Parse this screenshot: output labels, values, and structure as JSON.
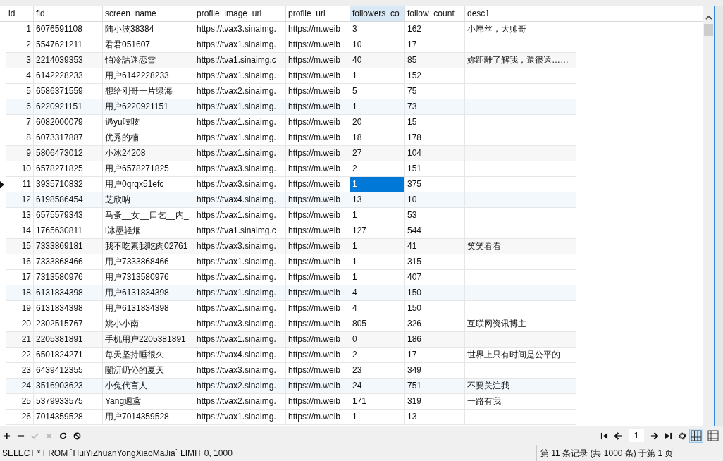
{
  "table": {
    "columns": [
      {
        "label": "id",
        "selected": false
      },
      {
        "label": "fid",
        "selected": false
      },
      {
        "label": "screen_name",
        "selected": false
      },
      {
        "label": "profile_image_url",
        "selected": false
      },
      {
        "label": "profile_url",
        "selected": false
      },
      {
        "label": "followers_co",
        "selected": true
      },
      {
        "label": "follow_count",
        "selected": false
      },
      {
        "label": "desc1",
        "selected": false
      }
    ],
    "rows": [
      {
        "selected": false,
        "cells": [
          "1",
          "6076591108",
          "陆小波38384",
          "https://tvax3.sinaimg.",
          "https://m.weib",
          "3",
          "162",
          "小屌丝，大帅哥"
        ]
      },
      {
        "selected": false,
        "cells": [
          "2",
          "5547621211",
          "君君051607",
          "https://tvax1.sinaimg.",
          "https://m.weib",
          "10",
          "17",
          ""
        ]
      },
      {
        "selected": false,
        "cells": [
          "3",
          "2214039353",
          "怕冷詁迷恋雪",
          "https://tva1.sinaimg.c",
          "https://m.weib",
          "40",
          "85",
          "妳距離了解我，還很遠……"
        ]
      },
      {
        "selected": false,
        "cells": [
          "4",
          "6142228233",
          "用户6142228233",
          "https://tvax1.sinaimg.",
          "https://m.weib",
          "1",
          "152",
          ""
        ]
      },
      {
        "selected": false,
        "cells": [
          "5",
          "6586371559",
          "想给刚哥一片绿海",
          "https://tvax2.sinaimg.",
          "https://m.weib",
          "5",
          "75",
          ""
        ]
      },
      {
        "selected": false,
        "cells": [
          "6",
          "6220921151",
          "用户6220921151",
          "https://tvax1.sinaimg.",
          "https://m.weib",
          "1",
          "73",
          ""
        ]
      },
      {
        "selected": false,
        "cells": [
          "7",
          "6082000079",
          "遇yu吱吱",
          "https://tvax1.sinaimg.",
          "https://m.weib",
          "20",
          "15",
          ""
        ]
      },
      {
        "selected": false,
        "cells": [
          "8",
          "6073317887",
          "优秀的楠",
          "https://tvax1.sinaimg.",
          "https://m.weib",
          "18",
          "178",
          ""
        ]
      },
      {
        "selected": false,
        "cells": [
          "9",
          "5806473012",
          "小冰24208",
          "https://tvax1.sinaimg.",
          "https://m.weib",
          "27",
          "104",
          ""
        ]
      },
      {
        "selected": false,
        "cells": [
          "10",
          "6578271825",
          "用户6578271825",
          "https://tvax3.sinaimg.",
          "https://m.weib",
          "2",
          "151",
          ""
        ]
      },
      {
        "selected": true,
        "cells": [
          "11",
          "3935710832",
          "用户0qrqx51efc",
          "https://tvax3.sinaimg.",
          "https://m.weib",
          "1",
          "375",
          ""
        ]
      },
      {
        "selected": false,
        "cells": [
          "12",
          "6198586454",
          "芝欣呐",
          "https://tvax4.sinaimg.",
          "https://m.weib",
          "13",
          "10",
          ""
        ]
      },
      {
        "selected": false,
        "cells": [
          "13",
          "6575579343",
          "马蚤__女__口乞__内_",
          "https://tvax1.sinaimg.",
          "https://m.weib",
          "1",
          "53",
          ""
        ]
      },
      {
        "selected": false,
        "cells": [
          "14",
          "1765630811",
          "i冰墨轻烟",
          "https://tva1.sinaimg.c",
          "https://m.weib",
          "127",
          "544",
          ""
        ]
      },
      {
        "selected": false,
        "cells": [
          "15",
          "7333869181",
          "我不吃素我吃肉02761",
          "https://tvax3.sinaimg.",
          "https://m.weib",
          "1",
          "41",
          "笑笑看看"
        ]
      },
      {
        "selected": false,
        "cells": [
          "16",
          "7333868466",
          "用户7333868466",
          "https://tvax1.sinaimg.",
          "https://m.weib",
          "1",
          "315",
          ""
        ]
      },
      {
        "selected": false,
        "cells": [
          "17",
          "7313580976",
          "用户7313580976",
          "https://tvax1.sinaimg.",
          "https://m.weib",
          "1",
          "407",
          ""
        ]
      },
      {
        "selected": false,
        "cells": [
          "18",
          "6131834398",
          "用户6131834398",
          "https://tvax1.sinaimg.",
          "https://m.weib",
          "4",
          "150",
          ""
        ]
      },
      {
        "selected": false,
        "cells": [
          "19",
          "6131834398",
          "用户6131834398",
          "https://tvax1.sinaimg.",
          "https://m.weib",
          "4",
          "150",
          ""
        ]
      },
      {
        "selected": false,
        "cells": [
          "20",
          "2302515767",
          "姚小小南",
          "https://tvax3.sinaimg.",
          "https://m.weib",
          "805",
          "326",
          "互联网资讯博主"
        ]
      },
      {
        "selected": false,
        "cells": [
          "21",
          "2205381891",
          "手机用户2205381891",
          "https://tvax1.sinaimg.",
          "https://m.weib",
          "0",
          "186",
          ""
        ]
      },
      {
        "selected": false,
        "cells": [
          "22",
          "6501824271",
          "每天坚持睡很久",
          "https://tvax4.sinaimg.",
          "https://m.weib",
          "2",
          "17",
          "世界上只有时间是公平的"
        ]
      },
      {
        "selected": false,
        "cells": [
          "23",
          "6439412355",
          "闄汧屷伈的夏天",
          "https://tvax3.sinaimg.",
          "https://m.weib",
          "23",
          "349",
          ""
        ]
      },
      {
        "selected": false,
        "cells": [
          "24",
          "3516903623",
          "小兔代言人",
          "https://tvax2.sinaimg.",
          "https://m.weib",
          "24",
          "751",
          "不要关注我"
        ]
      },
      {
        "selected": false,
        "cells": [
          "25",
          "5379933575",
          "Yang迴鸢",
          "https://tvax2.sinaimg.",
          "https://m.weib",
          "171",
          "319",
          "一路有我"
        ]
      },
      {
        "selected": false,
        "cells": [
          "26",
          "7014359528",
          "用户7014359528",
          "https://tvax1.sinaimg.",
          "https://m.weib",
          "1",
          "13",
          ""
        ]
      }
    ]
  },
  "pager": {
    "page": "1"
  },
  "view": {
    "grid_selected": true
  },
  "status_bar": {
    "query": "SELECT * FROM `HuiYiZhuanYongXiaoMaJia` LIMIT 0, 1000",
    "record": "第 11 条记录 (共 1000 条) 于第 1 页"
  }
}
